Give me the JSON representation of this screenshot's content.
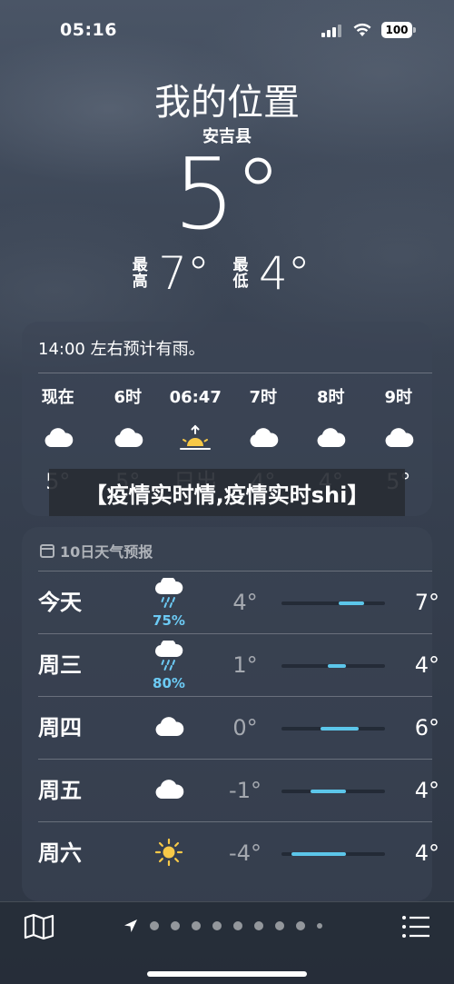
{
  "status_bar": {
    "time": "05:16",
    "battery": "100"
  },
  "header": {
    "location": "我的位置",
    "sublocation": "安吉县",
    "current_temp": "5°",
    "high_label": "最高",
    "high_value": "7°",
    "low_label": "最低",
    "low_value": "4°"
  },
  "hourly": {
    "summary": "14:00 左右预计有雨。",
    "hours": [
      {
        "time": "现在",
        "icon": "cloud-icon",
        "temp": "5°"
      },
      {
        "time": "6时",
        "icon": "cloud-icon",
        "temp": "5°"
      },
      {
        "time": "06:47",
        "icon": "sunrise-icon",
        "temp": "日出"
      },
      {
        "time": "7时",
        "icon": "cloud-icon",
        "temp": "4°"
      },
      {
        "time": "8时",
        "icon": "cloud-icon",
        "temp": "4°"
      },
      {
        "time": "9时",
        "icon": "cloud-icon",
        "temp": "5°"
      }
    ]
  },
  "banner": {
    "text": "【疫情实时情,疫情实时shi】"
  },
  "daily": {
    "title": "10日天气预报",
    "days": [
      {
        "day": "今天",
        "icon": "rain-cloud-icon",
        "precip": "75%",
        "low": "4°",
        "high": "7°",
        "range": [
          0.55,
          0.8
        ]
      },
      {
        "day": "周三",
        "icon": "rain-cloud-icon",
        "precip": "80%",
        "low": "1°",
        "high": "4°",
        "range": [
          0.45,
          0.62
        ]
      },
      {
        "day": "周四",
        "icon": "cloud-icon",
        "precip": "",
        "low": "0°",
        "high": "6°",
        "range": [
          0.38,
          0.75
        ]
      },
      {
        "day": "周五",
        "icon": "cloud-icon",
        "precip": "",
        "low": "-1°",
        "high": "4°",
        "range": [
          0.28,
          0.62
        ]
      },
      {
        "day": "周六",
        "icon": "sun-icon",
        "precip": "",
        "low": "-4°",
        "high": "4°",
        "range": [
          0.1,
          0.62
        ]
      }
    ]
  },
  "colors": {
    "temp_bar": "#5cc6ea",
    "precip": "#6ccaf4",
    "sun": "#f7c948"
  }
}
